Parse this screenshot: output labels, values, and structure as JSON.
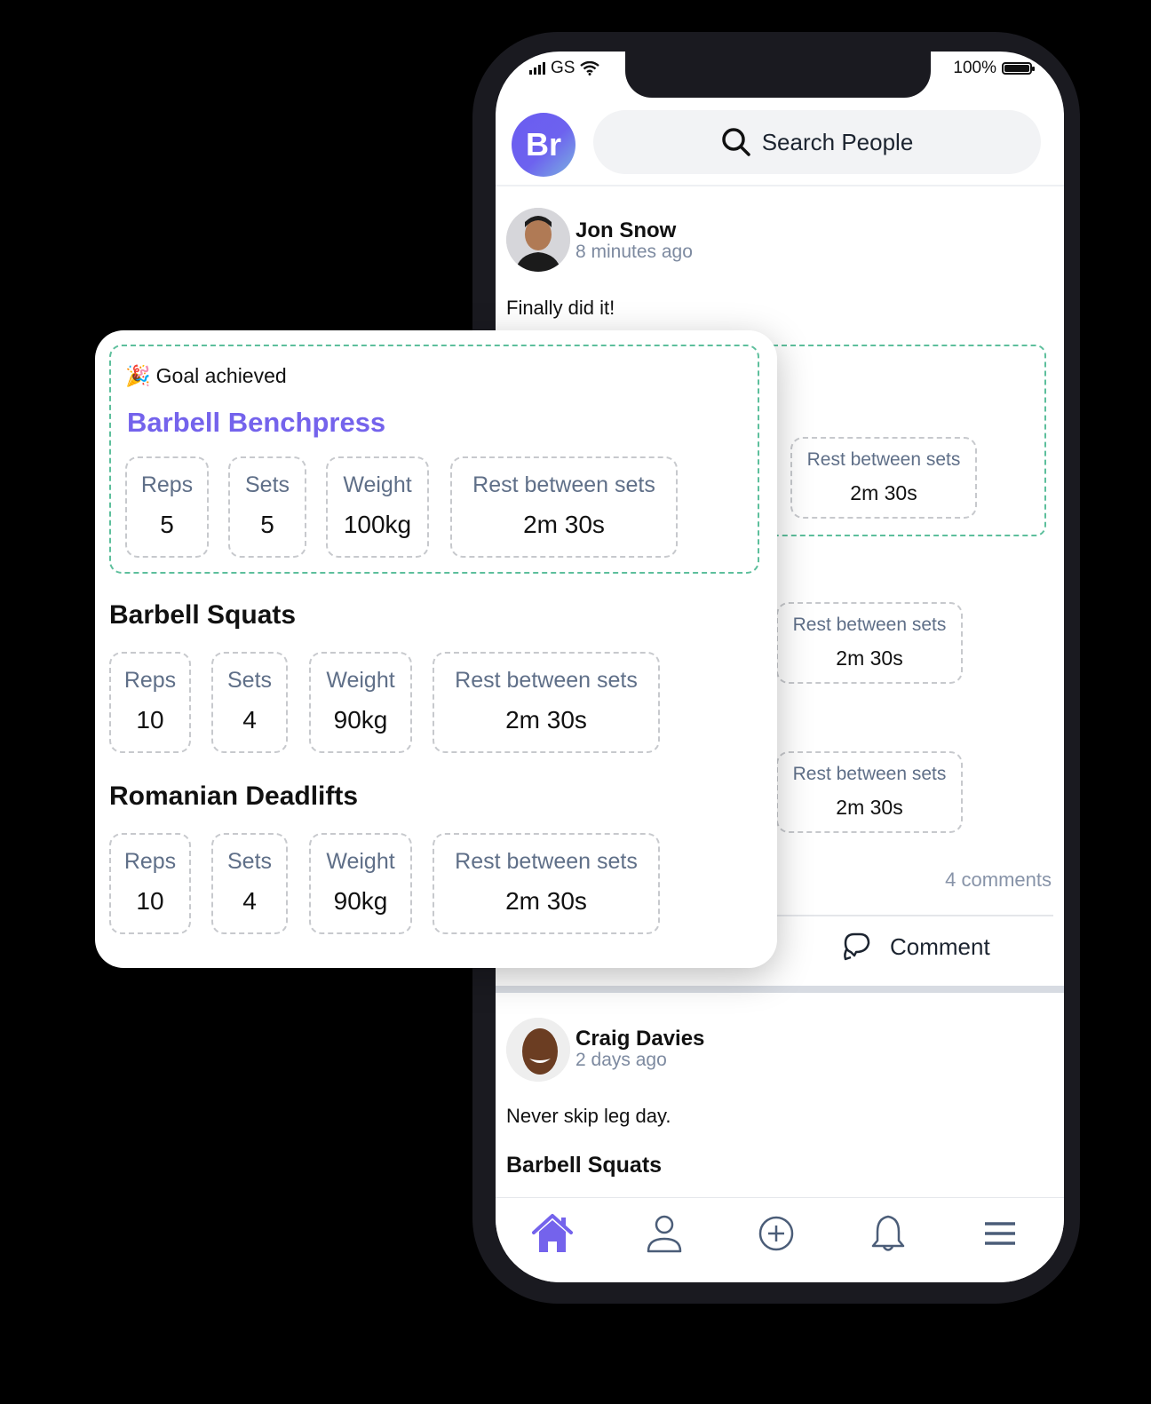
{
  "status_bar": {
    "carrier": "GS",
    "battery": "100%"
  },
  "header": {
    "logo_text": "Br",
    "search_placeholder": "Search People"
  },
  "posts": [
    {
      "author": "Jon Snow",
      "time": "8 minutes ago",
      "text": "Finally did it!",
      "comments_count": "4 comments",
      "comment_button": "Comment",
      "background_stats": [
        {
          "label": "Rest between sets",
          "value": "2m 30s"
        },
        {
          "label": "Rest between sets",
          "value": "2m 30s"
        },
        {
          "label": "Rest between sets",
          "value": "2m 30s"
        }
      ]
    },
    {
      "author": "Craig Davies",
      "time": "2 days ago",
      "text": "Never skip leg day.",
      "exercise": "Barbell Squats"
    }
  ],
  "workout_card": {
    "goal_label": "Goal achieved",
    "goal_emoji": "🎉",
    "exercises": [
      {
        "name": "Barbell Benchpress",
        "stats": [
          {
            "label": "Reps",
            "value": "5"
          },
          {
            "label": "Sets",
            "value": "5"
          },
          {
            "label": "Weight",
            "value": "100kg"
          },
          {
            "label": "Rest between sets",
            "value": "2m 30s"
          }
        ]
      },
      {
        "name": "Barbell Squats",
        "stats": [
          {
            "label": "Reps",
            "value": "10"
          },
          {
            "label": "Sets",
            "value": "4"
          },
          {
            "label": "Weight",
            "value": "90kg"
          },
          {
            "label": "Rest between sets",
            "value": "2m 30s"
          }
        ]
      },
      {
        "name": "Romanian Deadlifts",
        "stats": [
          {
            "label": "Reps",
            "value": "10"
          },
          {
            "label": "Sets",
            "value": "4"
          },
          {
            "label": "Weight",
            "value": "90kg"
          },
          {
            "label": "Rest between sets",
            "value": "2m 30s"
          }
        ]
      }
    ]
  },
  "tab_bar": {
    "items": [
      {
        "name": "home",
        "icon": "home-icon",
        "active": true
      },
      {
        "name": "profile",
        "icon": "user-icon",
        "active": false
      },
      {
        "name": "add",
        "icon": "plus-circle-icon",
        "active": false
      },
      {
        "name": "notifications",
        "icon": "bell-icon",
        "active": false
      },
      {
        "name": "menu",
        "icon": "menu-icon",
        "active": false
      }
    ],
    "active_color": "#7463ec",
    "inactive_color": "#4b5d78"
  }
}
